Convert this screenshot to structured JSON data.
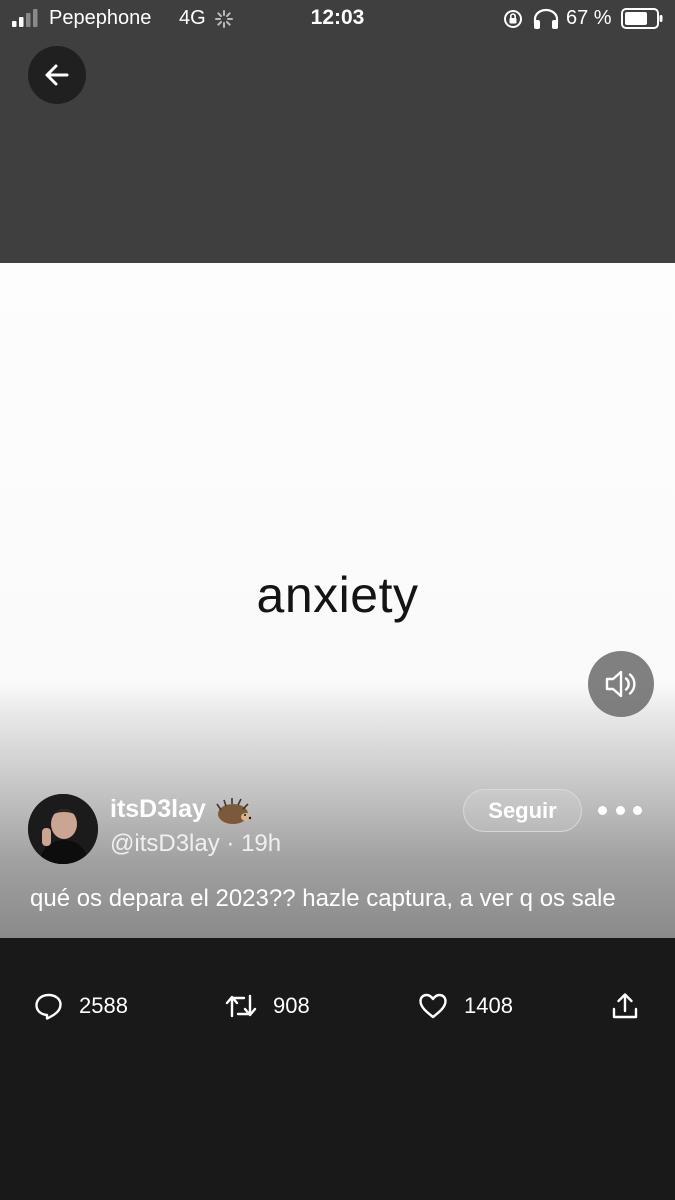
{
  "status_bar": {
    "carrier": "Pepephone",
    "network": "4G",
    "time": "12:03",
    "battery_percent": "67 %"
  },
  "icons": {
    "back": "arrow-left-icon",
    "sound": "speaker-icon",
    "reply": "reply-bubble-icon",
    "retweet": "retweet-icon",
    "like": "heart-icon",
    "share": "share-upload-icon"
  },
  "media": {
    "caption": "anxiety"
  },
  "tweet": {
    "display_name": "itsD3lay",
    "handle": "@itsD3lay",
    "separator": "·",
    "age": "19h",
    "follow_label": "Seguir",
    "text": "qué os depara el 2023?? hazle captura, a ver q os sale"
  },
  "stats": {
    "replies": "2588",
    "retweets": "908",
    "likes": "1408"
  },
  "colors": {
    "top_background": "#3f3f3f",
    "bottom_background": "#191919",
    "media_background": "#fdfdfd"
  }
}
